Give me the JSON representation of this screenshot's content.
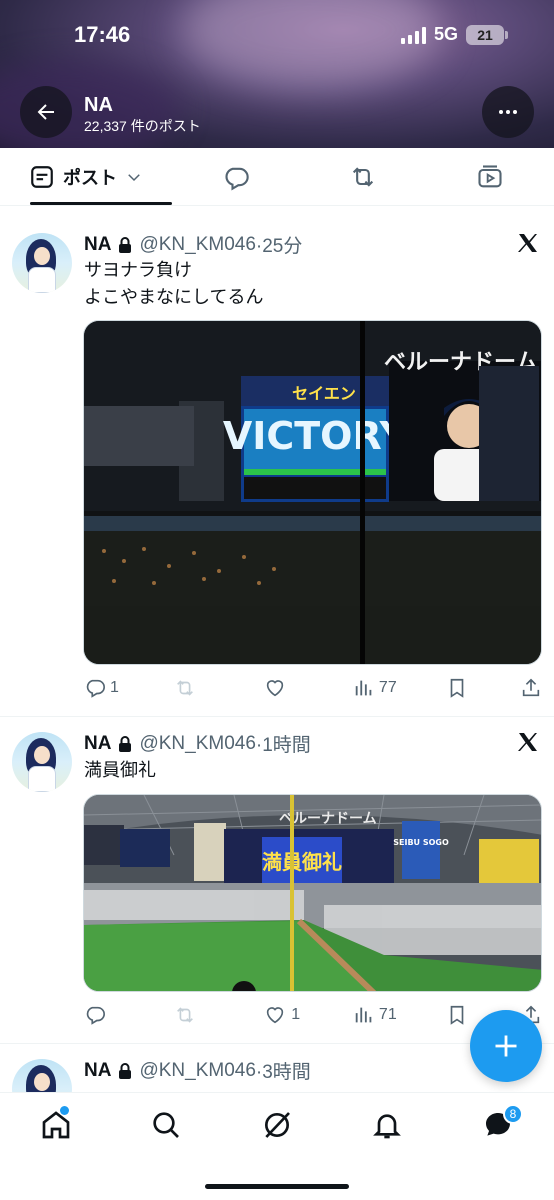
{
  "status_bar": {
    "time": "17:46",
    "network": "5G",
    "battery": "21"
  },
  "profile_header": {
    "name": "NA",
    "post_count": "22,337 件のポスト"
  },
  "tabs": [
    {
      "label": "ポスト",
      "icon": "list-icon",
      "active": true
    },
    {
      "label": "",
      "icon": "reply-icon"
    },
    {
      "label": "",
      "icon": "repost-icon"
    },
    {
      "label": "",
      "icon": "media-icon"
    }
  ],
  "posts": [
    {
      "name": "NA",
      "handle": "@KN_KM046",
      "time": "·25分",
      "lines": [
        "サヨナラ負け",
        "よこやまなにしてるん"
      ],
      "media_alt": "stadium scoreboard victory",
      "stats": {
        "replies": "1",
        "reposts": "",
        "likes": "",
        "views": "77"
      }
    },
    {
      "name": "NA",
      "handle": "@KN_KM046",
      "time": "·1時間",
      "lines": [
        "満員御礼"
      ],
      "media_alt": "stadium crowd",
      "stats": {
        "replies": "",
        "reposts": "",
        "likes": "1",
        "views": "71"
      }
    },
    {
      "name": "NA",
      "handle": "@KN_KM046",
      "time": "·3時間",
      "lines": [
        ""
      ]
    }
  ],
  "media": {
    "victory_screen_text": "VICTORY",
    "stadium_logo": "ベルーナドーム",
    "banner_text": "セイエン",
    "board_text": "満員御礼",
    "sign_text": "SEIBU SOGO"
  },
  "bottom_nav": {
    "messages_badge": "8"
  },
  "colors": {
    "accent": "#1d9bf0",
    "text": "#0f1419",
    "muted": "#536471"
  }
}
